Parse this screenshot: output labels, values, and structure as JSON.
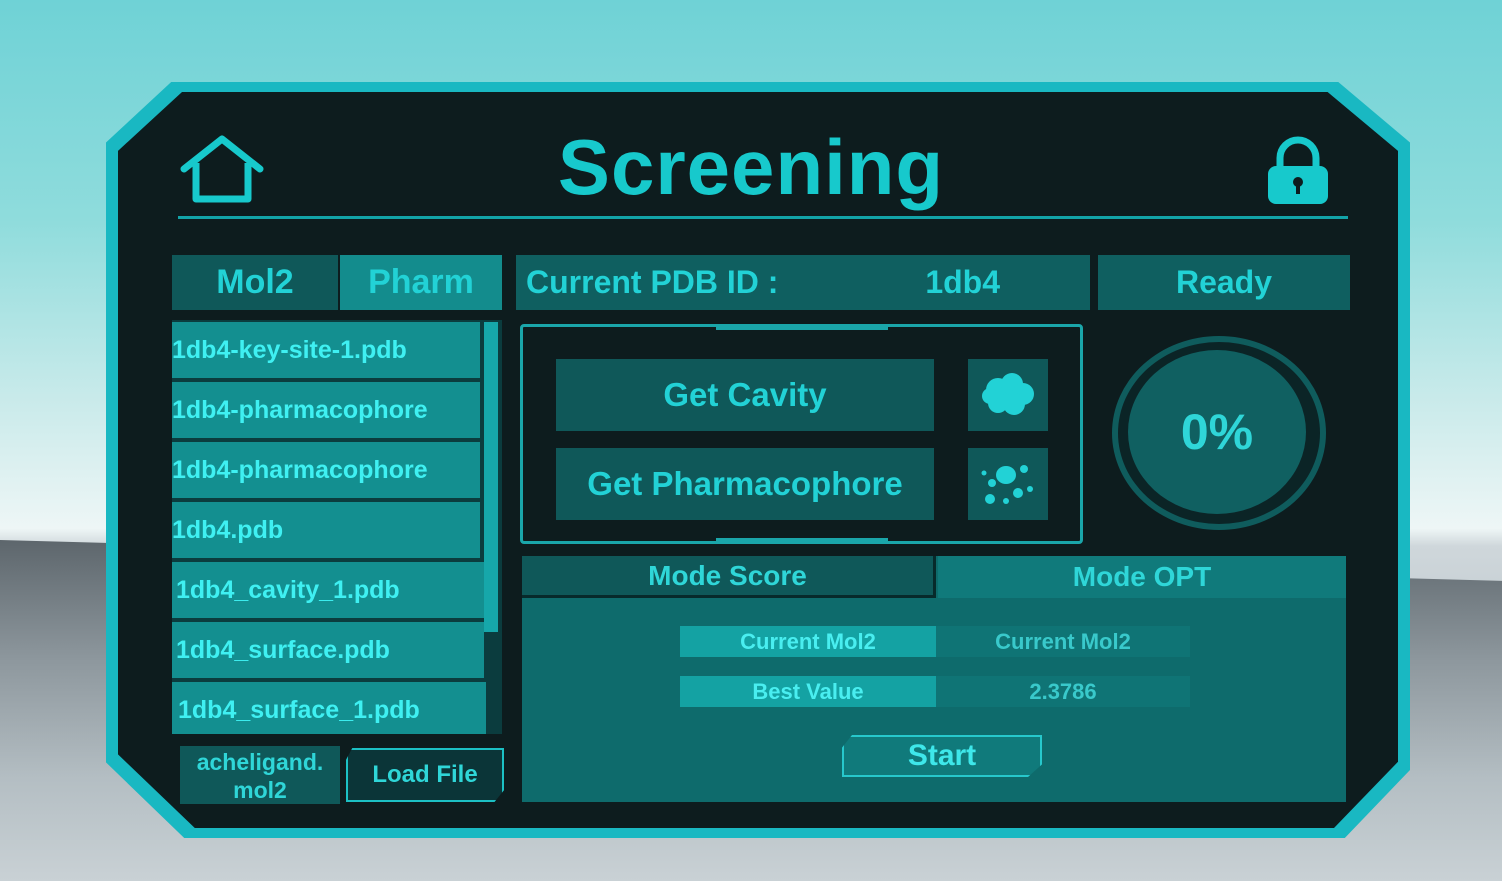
{
  "header": {
    "title": "Screening",
    "home_icon": "home-icon",
    "lock_icon": "lock-icon"
  },
  "tabs": [
    {
      "label": "Mol2",
      "active": false
    },
    {
      "label": "Pharm",
      "active": true
    }
  ],
  "pdb": {
    "label": "Current PDB ID :",
    "value": "1db4"
  },
  "status": "Ready",
  "files": [
    "1db4-key-site-1.pdb",
    "1db4-pharmacophore",
    "1db4-pharmacophore",
    "1db4.pdb",
    "1db4_cavity_1.pdb",
    "1db4_surface.pdb",
    "1db4_surface_1.pdb"
  ],
  "ligand": {
    "name_line1": "acheligand.",
    "name_line2": "mol2",
    "load_label": "Load File"
  },
  "actions": {
    "get_cavity": "Get Cavity",
    "get_pharmacophore": "Get Pharmacophore",
    "cavity_icon": "cloud-icon",
    "pharmacophore_icon": "dots-icon"
  },
  "progress": {
    "text": "0%",
    "value": 0
  },
  "modes": {
    "score": "Mode Score",
    "opt": "Mode OPT"
  },
  "fields": {
    "current_mol2_label": "Current Mol2",
    "current_mol2_value": "Current Mol2",
    "best_value_label": "Best Value",
    "best_value_value": "2.3786"
  },
  "start_label": "Start",
  "colors": {
    "accent": "#17c9cc",
    "panel": "#0d1c1e",
    "button": "#0f5859"
  }
}
